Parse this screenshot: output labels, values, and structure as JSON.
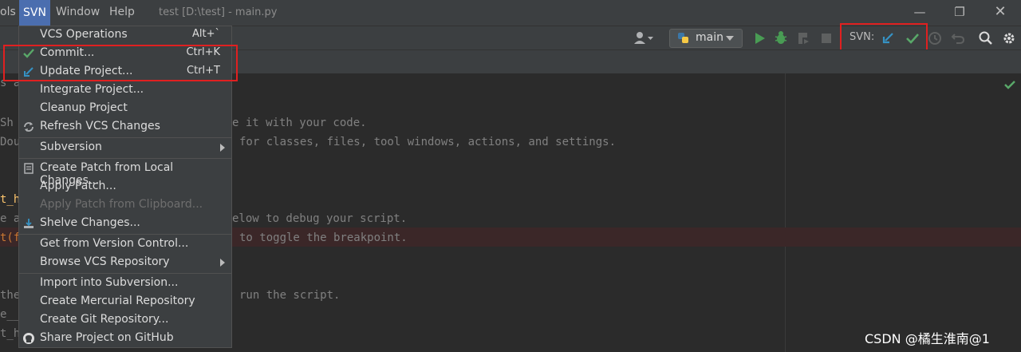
{
  "menubar": {
    "items": [
      "ols",
      "SVN",
      "Window",
      "Help"
    ],
    "title": "test [D:\\test] - main.py"
  },
  "toolbar": {
    "run_config": "main",
    "svn_label": "SVN:"
  },
  "editor": {
    "lines": [
      {
        "text": "s a",
        "style": "gray"
      },
      {
        "text": "Sh",
        "style": "gray"
      },
      {
        "text": "e it with your code.",
        "style": "gray"
      },
      {
        "text": "Dou",
        "style": "gray"
      },
      {
        "text": "for classes, files, tool windows, actions, and settings.",
        "style": "gray"
      },
      {
        "text": "t_h",
        "style": "yellow"
      },
      {
        "text": "e a",
        "style": "gray"
      },
      {
        "text": "elow to debug your script.",
        "style": "gray"
      },
      {
        "text": "t(f",
        "style": "orange"
      },
      {
        "text": "to toggle the breakpoint.",
        "style": "gray"
      },
      {
        "text": "the",
        "style": "gray"
      },
      {
        "text": "run the script.",
        "style": "gray"
      },
      {
        "text": "e__",
        "style": "gray"
      },
      {
        "text": "t_h",
        "style": "gray"
      }
    ]
  },
  "dropdown": {
    "items": [
      {
        "label": "VCS Operations",
        "shortcut": "Alt+`",
        "icon": "",
        "disabled": false,
        "submenu": false
      },
      {
        "label": "Commit...",
        "shortcut": "Ctrl+K",
        "icon": "check-icon",
        "disabled": false,
        "submenu": false
      },
      {
        "label": "Update Project...",
        "shortcut": "Ctrl+T",
        "icon": "update-arrow-icon",
        "disabled": false,
        "submenu": false
      },
      {
        "label": "Integrate Project...",
        "shortcut": "",
        "icon": "",
        "disabled": false,
        "submenu": false
      },
      {
        "label": "Cleanup Project",
        "shortcut": "",
        "icon": "",
        "disabled": false,
        "submenu": false
      },
      {
        "label": "Refresh VCS Changes",
        "shortcut": "",
        "icon": "refresh-icon",
        "disabled": false,
        "submenu": false
      },
      {
        "label": "Subversion",
        "shortcut": "",
        "icon": "",
        "disabled": false,
        "submenu": true
      },
      {
        "label": "Create Patch from Local Changes...",
        "shortcut": "",
        "icon": "patch-icon",
        "disabled": false,
        "submenu": false
      },
      {
        "label": "Apply Patch...",
        "shortcut": "",
        "icon": "",
        "disabled": false,
        "submenu": false
      },
      {
        "label": "Apply Patch from Clipboard...",
        "shortcut": "",
        "icon": "",
        "disabled": true,
        "submenu": false
      },
      {
        "label": "Shelve Changes...",
        "shortcut": "",
        "icon": "shelve-icon",
        "disabled": false,
        "submenu": false
      },
      {
        "label": "Get from Version Control...",
        "shortcut": "",
        "icon": "",
        "disabled": false,
        "submenu": false
      },
      {
        "label": "Browse VCS Repository",
        "shortcut": "",
        "icon": "",
        "disabled": false,
        "submenu": true
      },
      {
        "label": "Import into Subversion...",
        "shortcut": "",
        "icon": "",
        "disabled": false,
        "submenu": false
      },
      {
        "label": "Create Mercurial Repository",
        "shortcut": "",
        "icon": "",
        "disabled": false,
        "submenu": false
      },
      {
        "label": "Create Git Repository...",
        "shortcut": "",
        "icon": "",
        "disabled": false,
        "submenu": false
      },
      {
        "label": "Share Project on GitHub",
        "shortcut": "",
        "icon": "github-icon",
        "disabled": false,
        "submenu": false
      }
    ]
  },
  "watermark": "CSDN @橘生淮南@1",
  "colors": {
    "accent": "#4b6eaf",
    "annotation_red": "#e02020",
    "check_green": "#59a869",
    "update_blue": "#3592c4"
  }
}
